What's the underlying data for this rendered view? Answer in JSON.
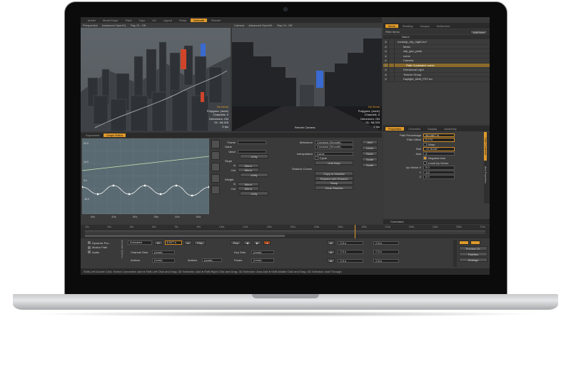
{
  "tabs": [
    "Model",
    "Model Dupe",
    "Paint",
    "Topo",
    "UV",
    "Layout",
    "Setup",
    "Animate",
    "Render"
  ],
  "active_tab": "Animate",
  "viewport_left": {
    "label": "Perspective",
    "shading": "Advanced OpenGL",
    "ray": "Ray GL: Off",
    "info": [
      "No Items",
      "Polygons: (none)",
      "Channels: 0",
      "Deformers: ON",
      "GL: 98,325",
      "5 fps"
    ]
  },
  "viewport_right": {
    "label": "Camera",
    "shading": "Advanced OpenGL",
    "ray": "Ray GL: Off",
    "info": [
      "No Items",
      "Polygons: (none)",
      "Channels: 0",
      "Deformers: ON",
      "GL: 98,325",
      "5 fps"
    ],
    "footer": "Render Camera"
  },
  "items_panel": {
    "tabs": [
      "Items",
      "Shading",
      "Groups",
      "Deformers"
    ],
    "filter_label": "Filter Items",
    "add_item": "Add Item",
    "column": "Name",
    "rows": [
      {
        "label": "nonstop_city_night.lxo*",
        "sel": false,
        "indent": 0
      },
      {
        "label": "Mesh",
        "sel": false,
        "indent": 2
      },
      {
        "label": "city_gen_parts",
        "sel": false,
        "indent": 2
      },
      {
        "label": "curve",
        "sel": false,
        "indent": 2
      },
      {
        "label": "Camera",
        "sel": false,
        "indent": 2
      },
      {
        "label": "Path Constraint: curve",
        "sel": true,
        "indent": 3
      },
      {
        "label": "Directional Light",
        "sel": false,
        "indent": 2
      },
      {
        "label": "Texture Group",
        "sel": false,
        "indent": 2
      },
      {
        "label": "Daylight_8AM_PST.lxo",
        "sel": false,
        "indent": 2
      }
    ]
  },
  "properties": {
    "tabs": [
      "Properties",
      "Channels",
      "Display",
      "Assembly"
    ],
    "rows": [
      {
        "label": "Path Percentage",
        "value": "58.1667 %"
      },
      {
        "label": "Path Offset",
        "value": "0.0 %"
      },
      {
        "label": "",
        "value": "Wrap"
      },
      {
        "label": "Roll",
        "value": "-17.8148 °"
      },
      {
        "label": "Axis",
        "value": "Z"
      },
      {
        "label": "",
        "value": "Negative Axis"
      },
      {
        "label": "",
        "value": "Local Up Vector"
      },
      {
        "label": "Up Vector X",
        "value": "0.0"
      },
      {
        "label": "Y",
        "value": "1.0"
      },
      {
        "label": "Z",
        "value": "0.0"
      }
    ],
    "side_labels": [
      "Path Constraint",
      "Item Properties"
    ],
    "command_label": "Command"
  },
  "graph_editor": {
    "tabs": [
      "Dopesheet",
      "Graph Editor"
    ],
    "y_labels": [
      "32.0",
      "16.0",
      "0.0",
      "-16.0"
    ],
    "x_labels": [
      "40s",
      "45s",
      "50s",
      "55s",
      "60s",
      "65s"
    ],
    "controls": {
      "frame": "Frame",
      "value": "Value",
      "slope": "Slope",
      "weight": "Weight",
      "in": "In",
      "out": "Out",
      "mirror": "Mirror",
      "unify": "Unify"
    },
    "behaviour": "Behaviour",
    "behaviour_val": "Constant (Smooth)",
    "behaviour_val2": "Constant (Smooth)",
    "interpolation": "Interpolation",
    "interpolation_val": "Curve",
    "cycle": "Cycle",
    "link_keys": "Link Keys",
    "shadow_curves": "Shadow Curves",
    "copy_to_shadow": "Copy to Shadow",
    "replace_with_shadow": "Replace with Shadow",
    "swap": "Swap",
    "clear_shadow": "Clear Shadow",
    "side_buttons": [
      "Add",
      "Undo",
      "Redo",
      "Scale",
      "Scale"
    ]
  },
  "timeline_labels": [
    "15s",
    "30s",
    "45s",
    "60s",
    "75s",
    "90s",
    "105s",
    "120s",
    "135s",
    "150s",
    "165s",
    "180s",
    "195s",
    "210s",
    "225s",
    "240s",
    "255s",
    "270s"
  ],
  "transport": {
    "dynamic_parent": "Dynamic Par...",
    "motion_path": "Motion Path",
    "audio": "Audio",
    "animated": "Animated",
    "time": "6.917 s",
    "play": "Play",
    "channel_sets": "Channel Sets",
    "channel_sets_val": "(none)",
    "actions": "Actions",
    "actions_val": "(none)",
    "key_sets": "Key Sets",
    "key_sets_val": "(none)",
    "poses": "Poses",
    "poses_val": "(none)",
    "key": "Key",
    "rate_vals": [
      "0.0 s",
      "0.0 s",
      "0.0 s"
    ],
    "preview_gl": "Preview GL",
    "palettes": "Palettes",
    "settings": "Settings",
    "anim_label": "Animate Options"
  },
  "status": "Shift-Left Double Click: Select Connected: Add ● Shift-Left Click and Drag: 3D Selection: Add ● Shift-Right Click and Drag: 3D Selection: Area Add ● Shift-Middle Click and Drag: 3D Selection: Add Through",
  "colors": {
    "accent": "#e09a2a",
    "selected": "#8a6a2a",
    "building_blue": "#3a6ad0",
    "building_red": "#d0452a"
  }
}
